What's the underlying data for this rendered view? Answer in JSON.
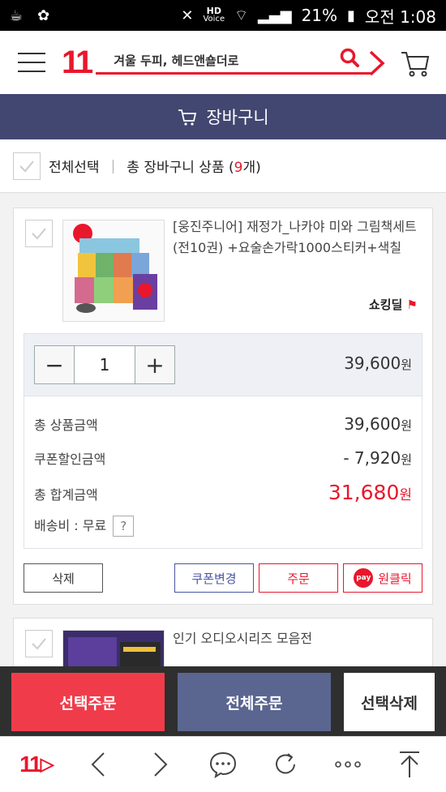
{
  "status": {
    "battery": "21%",
    "time": "오전 1:08",
    "hd_label": "HD",
    "voice_label": "Voice"
  },
  "header": {
    "logo": "11",
    "search_text": "겨울 두피, 헤드앤숄더로"
  },
  "titlebar": {
    "title": "장바구니"
  },
  "selectall": {
    "label": "전체선택",
    "total_prefix": "총 장바구니 상품 (",
    "count": "9",
    "total_suffix": "개)"
  },
  "item1": {
    "name": "[웅진주니어] 재정가_나카야 미와 그림책세트 (전10권) +요술손가락1000스티커+색칠",
    "shop_logo": "쇼킹딜",
    "quantity": "1",
    "unit_price": "39,600",
    "currency": "원",
    "total_label": "총 상품금액",
    "total_value": "39,600",
    "coupon_label": "쿠폰할인금액",
    "coupon_value": "- 7,920",
    "sum_label": "총 합계금액",
    "sum_value": "31,680",
    "shipping_label": "배송비 : 무료",
    "help": "?",
    "btn_delete": "삭제",
    "btn_coupon": "쿠폰변경",
    "btn_order": "주문",
    "btn_oneclick": "원클릭",
    "pay_label": "pay"
  },
  "item2": {
    "name": "인기 오디오시리즈 모음전"
  },
  "actions": {
    "select_order": "선택주문",
    "all_order": "전체주문",
    "delete_selected": "선택삭제"
  },
  "nav": {
    "logo": "11"
  },
  "colors": {
    "brand_red": "#e8172c",
    "title_navy": "#414770",
    "select_btn": "#f03c4a",
    "all_btn": "#5a6690"
  }
}
